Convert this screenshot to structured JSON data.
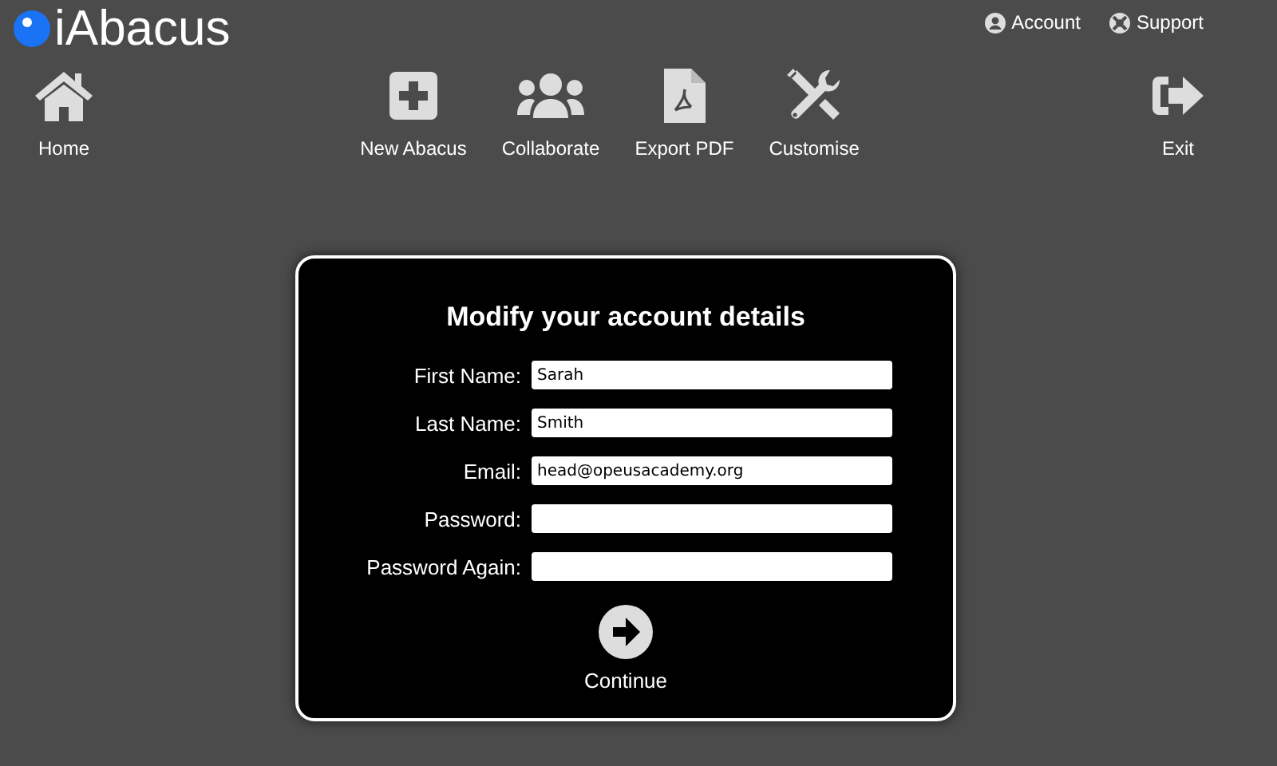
{
  "logo": {
    "text": "iAbacus"
  },
  "top_links": [
    {
      "kind": "account",
      "label": "Account"
    },
    {
      "kind": "support",
      "label": "Support"
    }
  ],
  "toolbar": {
    "left": [
      {
        "kind": "home",
        "label": "Home"
      }
    ],
    "center": [
      {
        "kind": "plus",
        "label": "New Abacus"
      },
      {
        "kind": "users",
        "label": "Collaborate"
      },
      {
        "kind": "pdf",
        "label": "Export PDF"
      },
      {
        "kind": "tools",
        "label": "Customise"
      }
    ],
    "right": [
      {
        "kind": "exit",
        "label": "Exit"
      }
    ]
  },
  "form": {
    "title": "Modify your account details",
    "fields": [
      {
        "label": "First Name:",
        "value": "Sarah"
      },
      {
        "label": "Last Name:",
        "value": "Smith"
      },
      {
        "label": "Email:",
        "value": "head@opeusacademy.org"
      },
      {
        "label": "Password:"
      },
      {
        "label": "Password Again:"
      }
    ],
    "submit": {
      "label": "Continue"
    }
  }
}
